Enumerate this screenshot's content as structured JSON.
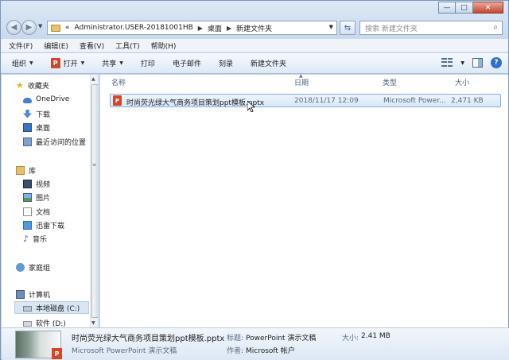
{
  "titlebar": {
    "minimize": "—",
    "maximize": "□",
    "close": "✕"
  },
  "address": {
    "prefix": "«",
    "crumbs": [
      "Administrator.USER-20181001HB",
      "桌面",
      "新建文件夹"
    ],
    "separator": "▶",
    "search_placeholder": "搜索 新建文件夹"
  },
  "menu": [
    "文件(F)",
    "编辑(E)",
    "查看(V)",
    "工具(T)",
    "帮助(H)"
  ],
  "commands": {
    "organize": "组织",
    "open": "打开",
    "share": "共享",
    "print": "打印",
    "email": "电子邮件",
    "burn": "刻录",
    "new_folder": "新建文件夹"
  },
  "nav": {
    "favorites": "收藏夹",
    "onedrive": "OneDrive",
    "downloads": "下载",
    "desktop": "桌面",
    "recent": "最近访问的位置",
    "libraries": "库",
    "videos": "视频",
    "pictures": "图片",
    "documents": "文档",
    "xunlei": "迅雷下载",
    "music": "音乐",
    "homegroup": "家庭组",
    "computer": "计算机",
    "local_disk": "本地磁盘 (C:)",
    "software_disk": "软件 (D:)"
  },
  "columns": {
    "name": "名称",
    "date": "日期",
    "type": "类型",
    "size": "大小"
  },
  "files": [
    {
      "name": "时尚荧光绿大气商务项目策划ppt模板.pptx",
      "date": "2018/11/17 12:09",
      "type": "Microsoft Power...",
      "size": "2,471 KB"
    }
  ],
  "details": {
    "filename": "时尚荧光绿大气商务项目策划ppt模板.pptx",
    "filetype": "Microsoft PowerPoint 演示文稿",
    "title_label": "标题:",
    "title_value": "PowerPoint 演示文稿",
    "author_label": "作者:",
    "author_value": "Microsoft 帐户",
    "size_label": "大小:",
    "size_value": "2.41 MB"
  },
  "colors": {
    "selection": "#d7e7fa",
    "ppt": "#d24726",
    "chrome": "#c3d6ec"
  }
}
